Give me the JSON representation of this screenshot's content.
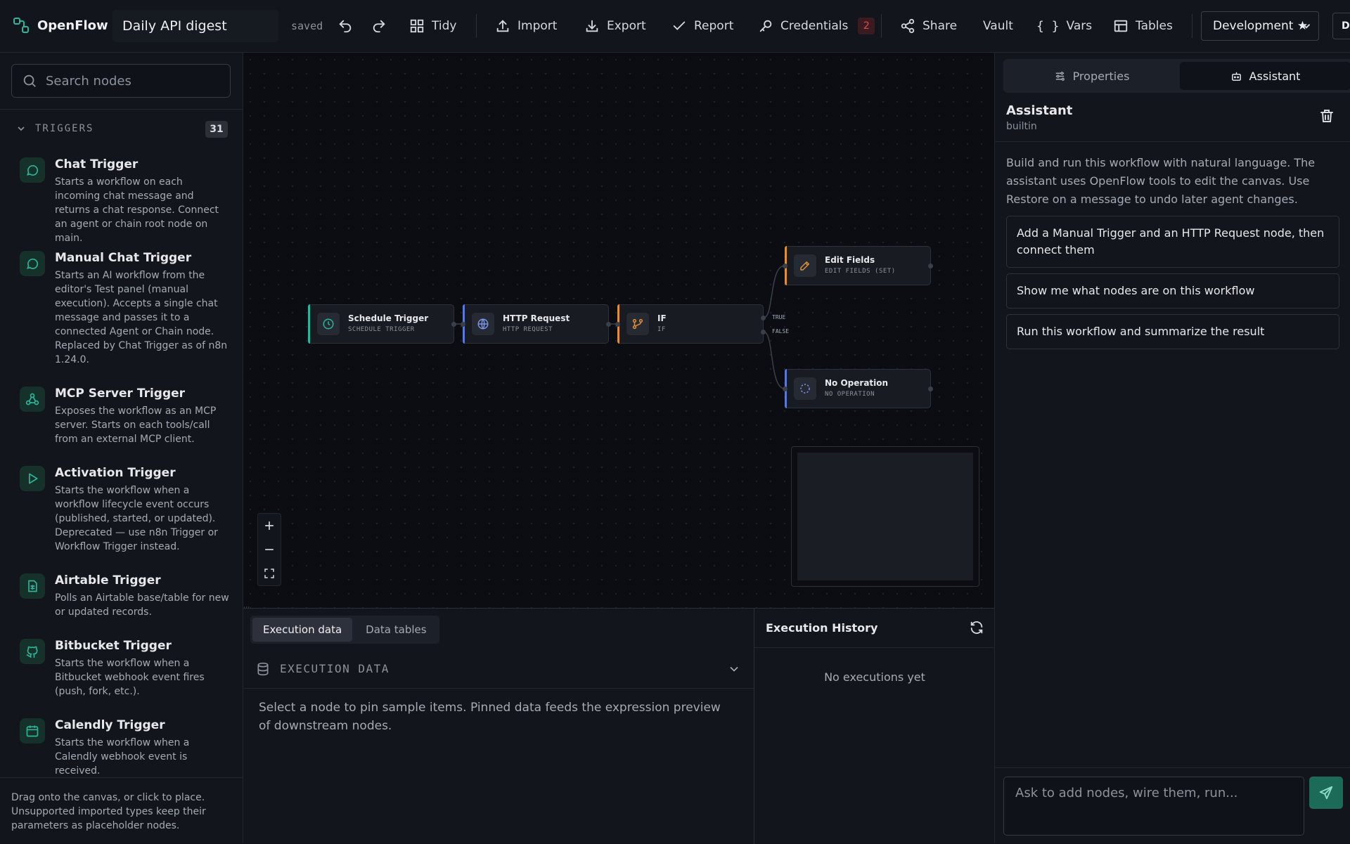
{
  "app": {
    "name": "OpenFlow",
    "workflow_title": "Daily API digest",
    "save_status": "saved"
  },
  "toolbar": {
    "tidy": "Tidy",
    "import": "Import",
    "export": "Export",
    "report": "Report",
    "credentials": "Credentials",
    "credentials_count": "2",
    "share": "Share",
    "vault": "Vault",
    "vars": "Vars",
    "tables": "Tables",
    "environment": "Development ★",
    "env_partial": "De"
  },
  "sidebar": {
    "search_placeholder": "Search nodes",
    "section_title": "TRIGGERS",
    "section_count": "31",
    "items": [
      {
        "title": "Chat Trigger",
        "desc": "Starts a workflow on each incoming chat message and returns a chat response. Connect an agent or chain root node on main.",
        "icon": "chat-icon"
      },
      {
        "title": "Manual Chat Trigger",
        "desc": "Starts an AI workflow from the editor's Test panel (manual execution). Accepts a single chat message and passes it to a connected Agent or Chain node. Replaced by Chat Trigger as of n8n 1.24.0.",
        "icon": "chat-icon"
      },
      {
        "title": "MCP Server Trigger",
        "desc": "Exposes the workflow as an MCP server. Starts on each tools/call from an external MCP client.",
        "icon": "webhook-icon"
      },
      {
        "title": "Activation Trigger",
        "desc": "Starts the workflow when a workflow lifecycle event occurs (published, started, or updated). Deprecated — use n8n Trigger or Workflow Trigger instead.",
        "icon": "play-icon"
      },
      {
        "title": "Airtable Trigger",
        "desc": "Polls an Airtable base/table for new or updated records.",
        "icon": "sheet-icon"
      },
      {
        "title": "Bitbucket Trigger",
        "desc": "Starts the workflow when a Bitbucket webhook event fires (push, fork, etc.).",
        "icon": "github-icon"
      },
      {
        "title": "Calendly Trigger",
        "desc": "Starts the workflow when a Calendly webhook event is received.",
        "icon": "calendar-icon"
      }
    ],
    "footer": "Drag onto the canvas, or click to place. Unsupported imported types keep their parameters as placeholder nodes."
  },
  "canvas": {
    "nodes": [
      {
        "name": "Schedule Trigger",
        "type": "SCHEDULE TRIGGER",
        "accent": "#2bb59a"
      },
      {
        "name": "HTTP Request",
        "type": "HTTP REQUEST",
        "accent": "#5b78d6"
      },
      {
        "name": "IF",
        "type": "IF",
        "accent": "#e0903a"
      },
      {
        "name": "Edit Fields",
        "type": "EDIT FIELDS (SET)",
        "accent": "#e0903a"
      },
      {
        "name": "No Operation",
        "type": "NO OPERATION",
        "accent": "#5b78d6"
      }
    ],
    "branch_true": "TRUE",
    "branch_false": "FALSE"
  },
  "bottom": {
    "tabs": [
      "Execution data",
      "Data tables"
    ],
    "exec_title": "EXECUTION DATA",
    "exec_message": "Select a node to pin sample items. Pinned data feeds the expression preview of downstream nodes.",
    "history_title": "Execution History",
    "history_empty": "No executions yet"
  },
  "assistant": {
    "tabs": [
      "Properties",
      "Assistant"
    ],
    "title": "Assistant",
    "subtitle": "builtin",
    "intro": "Build and run this workflow with natural language. The assistant uses OpenFlow tools to edit the canvas. Use Restore on a message to undo later agent changes.",
    "suggestions": [
      "Add a Manual Trigger and an HTTP Request node, then connect them",
      "Show me what nodes are on this workflow",
      "Run this workflow and summarize the result"
    ],
    "input_placeholder": "Ask to add nodes, wire them, run..."
  },
  "colors": {
    "accent": "#2bb59a",
    "badge": "#e5484d",
    "send": "#1c6b58"
  }
}
